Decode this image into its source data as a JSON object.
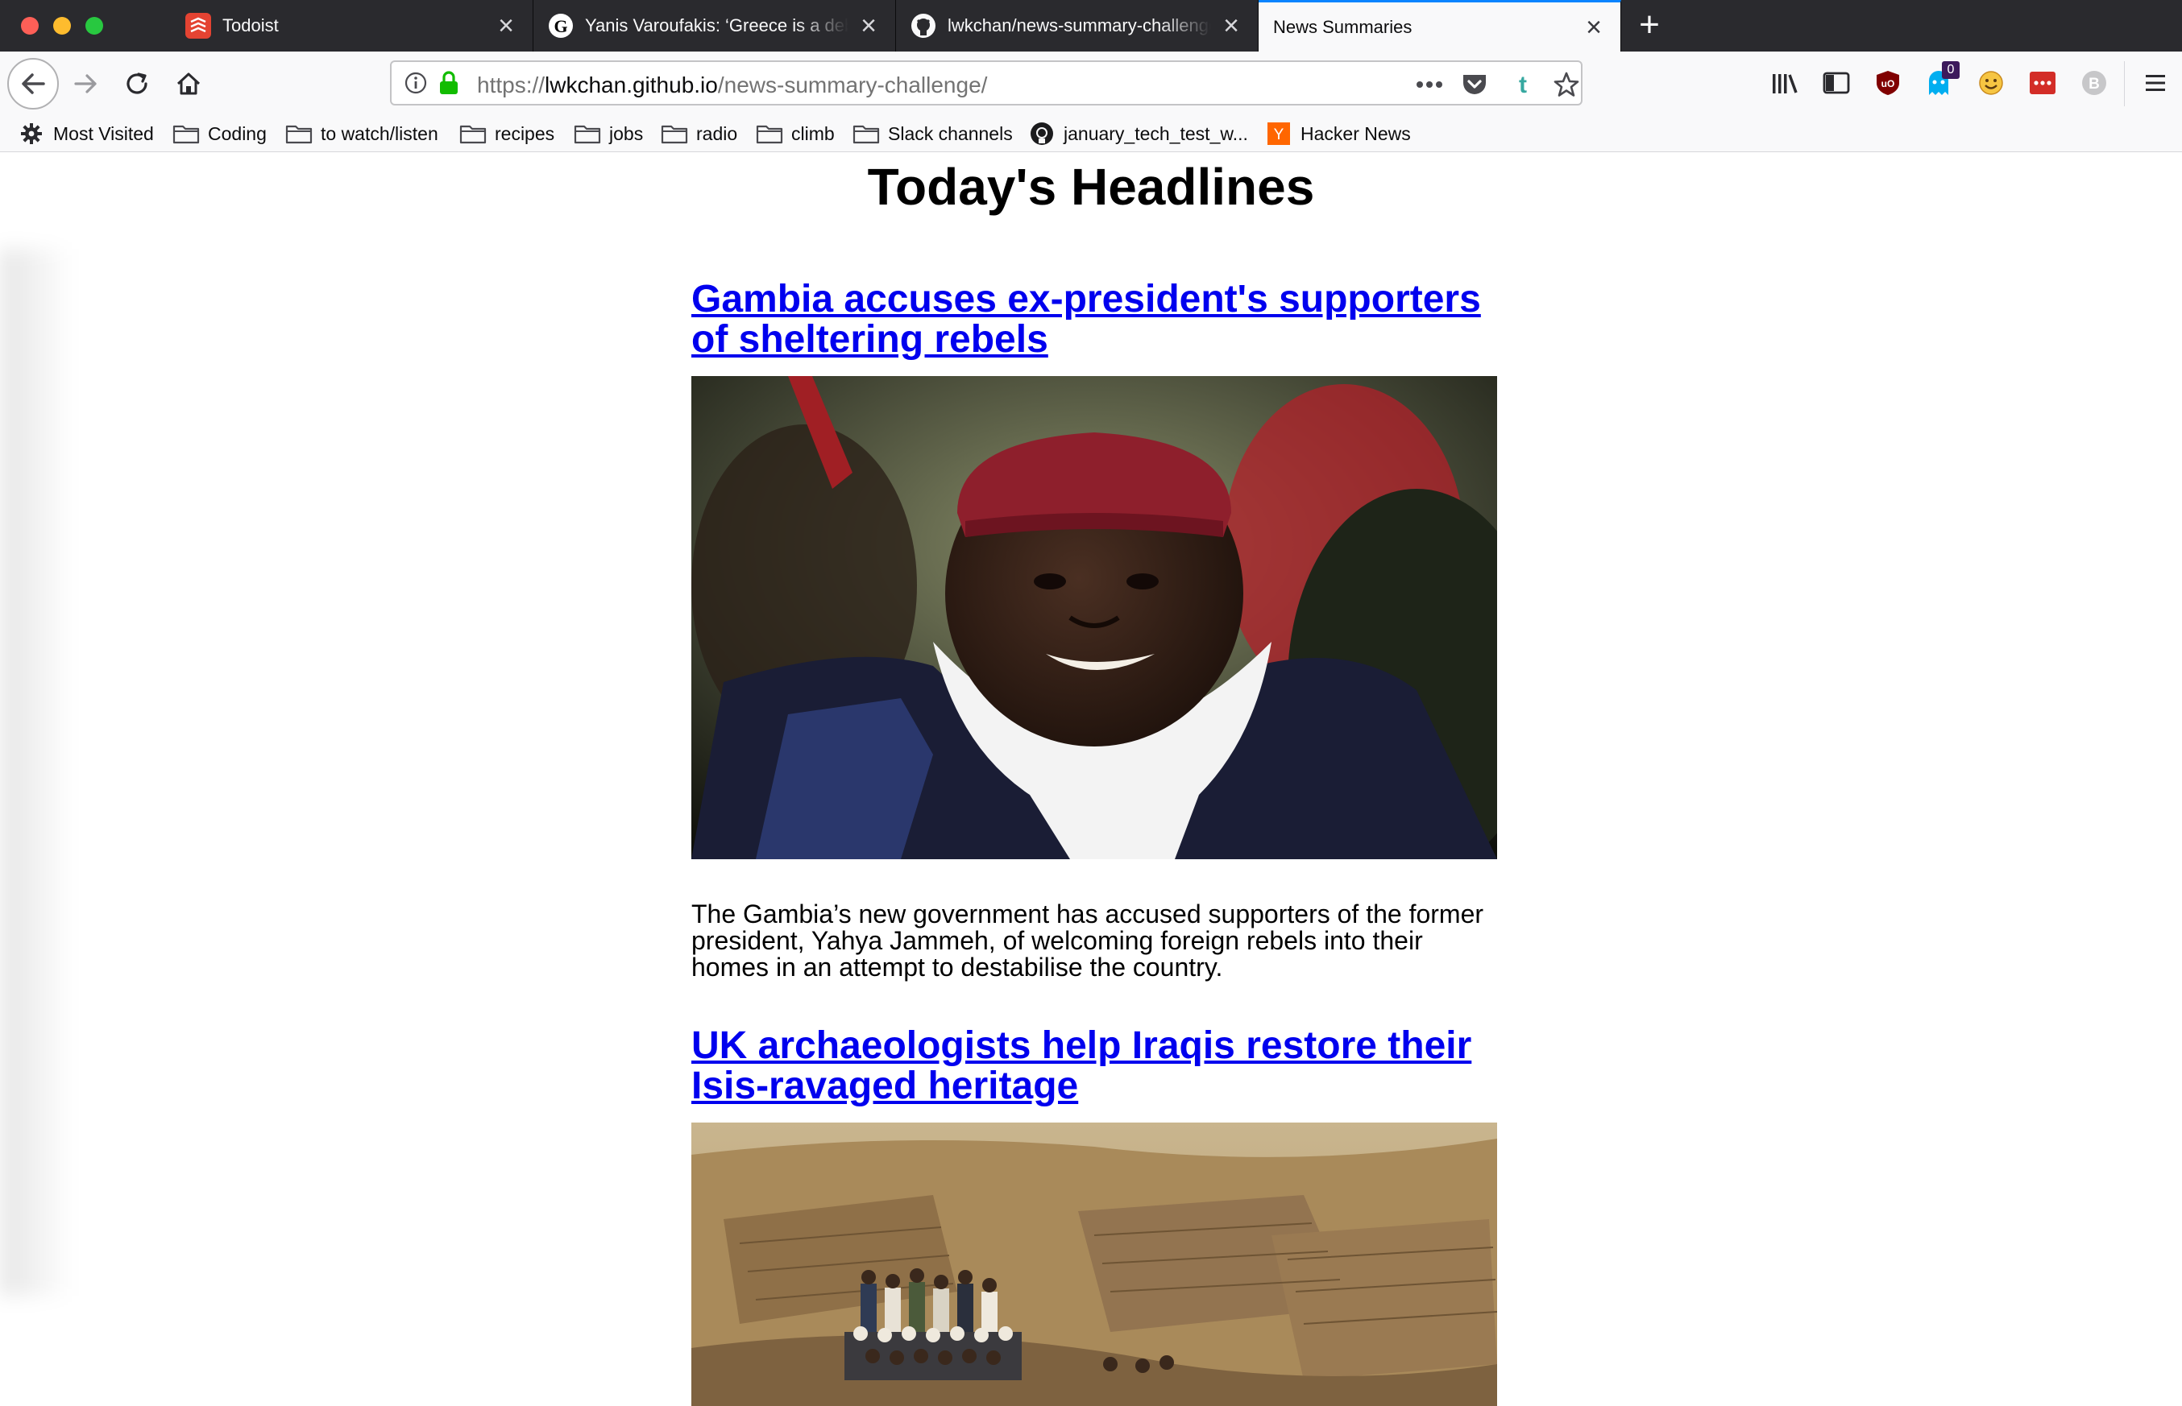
{
  "browser": {
    "tabs": [
      {
        "title": "Todoist",
        "favicon": "todoist-icon",
        "active": false
      },
      {
        "title": "Yanis Varoufakis: ‘Greece is a debt colony’",
        "favicon": "guardian-icon",
        "active": false
      },
      {
        "title": "lwkchan/news-summary-challenge",
        "favicon": "github-icon",
        "active": false
      },
      {
        "title": "News Summaries",
        "favicon": "",
        "active": true
      }
    ],
    "address": {
      "scheme": "https://",
      "host": "lwkchan.github.io",
      "path": "/news-summary-challenge/"
    },
    "notification_count": "0",
    "bookmarks": [
      {
        "label": "Most Visited",
        "icon": "gear-icon"
      },
      {
        "label": "Coding",
        "icon": "folder-icon"
      },
      {
        "label": "to watch/listen",
        "icon": "folder-icon"
      },
      {
        "label": "recipes",
        "icon": "folder-icon"
      },
      {
        "label": "jobs",
        "icon": "folder-icon"
      },
      {
        "label": "radio",
        "icon": "folder-icon"
      },
      {
        "label": "climb",
        "icon": "folder-icon"
      },
      {
        "label": "Slack channels",
        "icon": "folder-icon"
      },
      {
        "label": "january_tech_test_w...",
        "icon": "github-icon"
      },
      {
        "label": "Hacker News",
        "icon": "y-combinator-icon"
      }
    ]
  },
  "page": {
    "title": "Today's Headlines",
    "articles": [
      {
        "headline": "Gambia accuses ex-president's supporters of sheltering rebels",
        "image": "portrait-photo",
        "summary": "The Gambia’s new government has accused supporters of the former president, Yahya Jammeh, of welcoming foreign rebels into their homes in an attempt to destabilise the country."
      },
      {
        "headline": "UK archaeologists help Iraqis restore their Isis-ravaged heritage",
        "image": "archaeology-site-photo"
      }
    ]
  },
  "colors": {
    "link": "#0000ee",
    "tab_bar": "#2a2a2e",
    "accent": "#0a84ff",
    "lock": "#12bc00"
  }
}
